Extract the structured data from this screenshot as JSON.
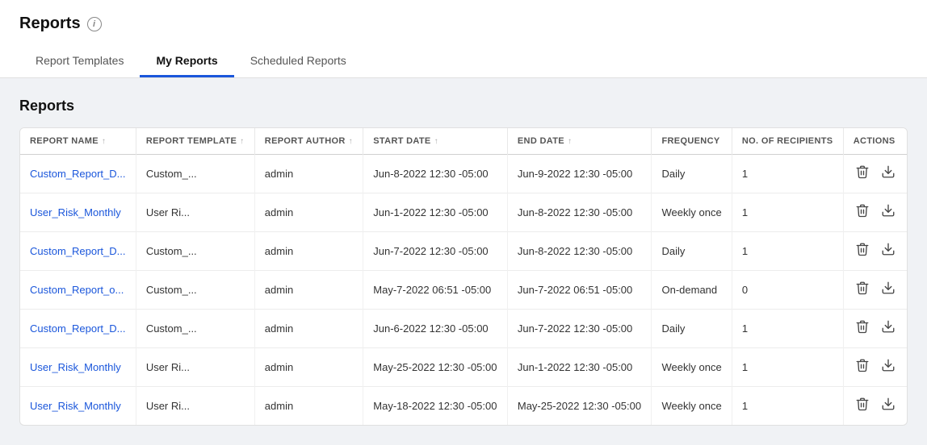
{
  "page": {
    "title": "Reports",
    "info_icon": "i"
  },
  "tabs": [
    {
      "id": "report-templates",
      "label": "Report Templates",
      "active": false
    },
    {
      "id": "my-reports",
      "label": "My Reports",
      "active": true
    },
    {
      "id": "scheduled-reports",
      "label": "Scheduled Reports",
      "active": false
    }
  ],
  "section": {
    "title": "Reports"
  },
  "table": {
    "columns": [
      {
        "id": "report-name",
        "label": "REPORT NAME"
      },
      {
        "id": "report-template",
        "label": "REPORT TEMPLATE"
      },
      {
        "id": "report-author",
        "label": "REPORT AUTHOR"
      },
      {
        "id": "start-date",
        "label": "START DATE"
      },
      {
        "id": "end-date",
        "label": "END DATE"
      },
      {
        "id": "frequency",
        "label": "FREQUENCY"
      },
      {
        "id": "no-of-recipients",
        "label": "NO. OF RECIPIENTS"
      },
      {
        "id": "actions",
        "label": "ACTIONS"
      }
    ],
    "rows": [
      {
        "report_name": "Custom_Report_D...",
        "report_template": "Custom_...",
        "report_author": "admin",
        "start_date": "Jun-8-2022 12:30 -05:00",
        "end_date": "Jun-9-2022 12:30 -05:00",
        "frequency": "Daily",
        "recipients": "1"
      },
      {
        "report_name": "User_Risk_Monthly",
        "report_template": "User Ri...",
        "report_author": "admin",
        "start_date": "Jun-1-2022 12:30 -05:00",
        "end_date": "Jun-8-2022 12:30 -05:00",
        "frequency": "Weekly once",
        "recipients": "1"
      },
      {
        "report_name": "Custom_Report_D...",
        "report_template": "Custom_...",
        "report_author": "admin",
        "start_date": "Jun-7-2022 12:30 -05:00",
        "end_date": "Jun-8-2022 12:30 -05:00",
        "frequency": "Daily",
        "recipients": "1"
      },
      {
        "report_name": "Custom_Report_o...",
        "report_template": "Custom_...",
        "report_author": "admin",
        "start_date": "May-7-2022 06:51 -05:00",
        "end_date": "Jun-7-2022 06:51 -05:00",
        "frequency": "On-demand",
        "recipients": "0"
      },
      {
        "report_name": "Custom_Report_D...",
        "report_template": "Custom_...",
        "report_author": "admin",
        "start_date": "Jun-6-2022 12:30 -05:00",
        "end_date": "Jun-7-2022 12:30 -05:00",
        "frequency": "Daily",
        "recipients": "1"
      },
      {
        "report_name": "User_Risk_Monthly",
        "report_template": "User Ri...",
        "report_author": "admin",
        "start_date": "May-25-2022 12:30 -05:00",
        "end_date": "Jun-1-2022 12:30 -05:00",
        "frequency": "Weekly once",
        "recipients": "1"
      },
      {
        "report_name": "User_Risk_Monthly",
        "report_template": "User Ri...",
        "report_author": "admin",
        "start_date": "May-18-2022 12:30 -05:00",
        "end_date": "May-25-2022 12:30 -05:00",
        "frequency": "Weekly once",
        "recipients": "1"
      }
    ]
  }
}
